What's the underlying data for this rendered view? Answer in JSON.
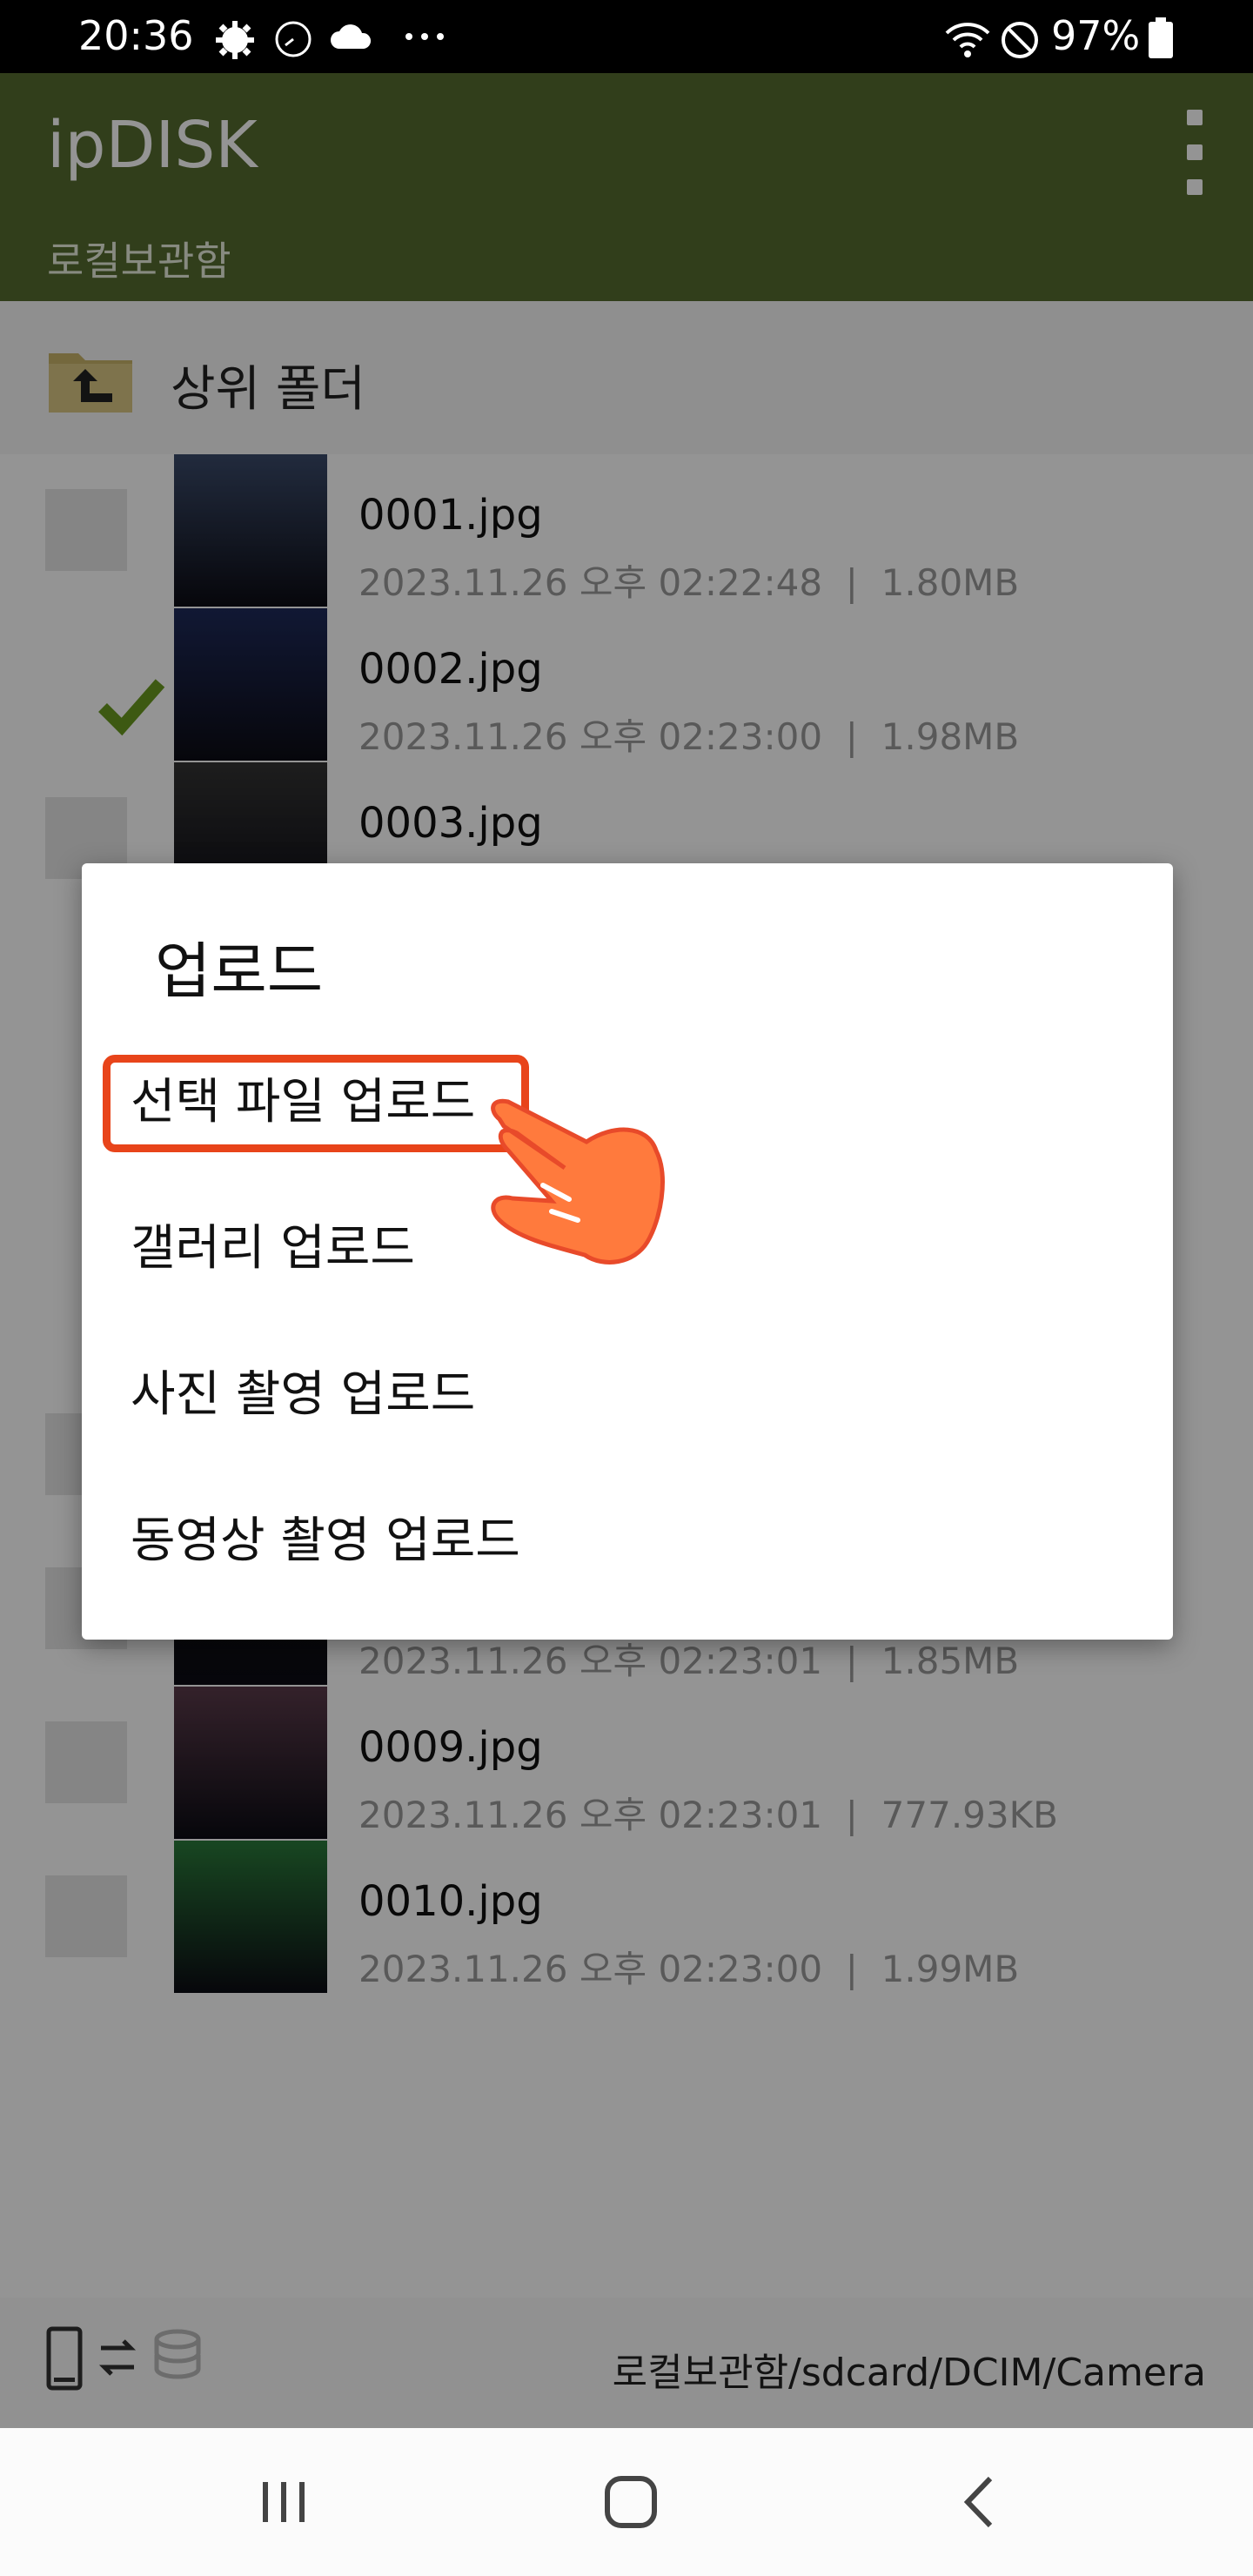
{
  "status_bar": {
    "time": "20:36",
    "battery": "97%"
  },
  "app_bar": {
    "title": "ipDISK",
    "subtitle": "로컬보관함"
  },
  "parent_folder": {
    "label": "상위 폴더"
  },
  "files": [
    {
      "name": "0001.jpg",
      "date": "2023.11.26 오후 02:22:48",
      "size": "1.80MB",
      "checked": false,
      "thumb_color": "#3a4a6a"
    },
    {
      "name": "0002.jpg",
      "date": "2023.11.26 오후 02:23:00",
      "size": "1.98MB",
      "checked": true,
      "thumb_color": "#1e2a5a"
    },
    {
      "name": "0003.jpg",
      "date": "",
      "size": "",
      "checked": false,
      "thumb_color": "#333333"
    },
    {
      "name": "",
      "date": "",
      "size": "",
      "checked": true,
      "thumb_color": "#444444"
    },
    {
      "name": "",
      "date": "",
      "size": "",
      "checked": true,
      "thumb_color": "#555555"
    },
    {
      "name": "",
      "date": "",
      "size": "",
      "checked": true,
      "thumb_color": "#444444"
    },
    {
      "name": "",
      "date": "",
      "size": "",
      "checked": false,
      "thumb_color": "#333333"
    },
    {
      "name": "",
      "date": "2023.11.26 오후 02:23:01",
      "size": "1.85MB",
      "checked": false,
      "thumb_color": "#111111"
    },
    {
      "name": "0009.jpg",
      "date": "2023.11.26 오후 02:23:01",
      "size": "777.93KB",
      "checked": false,
      "thumb_color": "#5a3a4a"
    },
    {
      "name": "0010.jpg",
      "date": "2023.11.26 오후 02:23:00",
      "size": "1.99MB",
      "checked": false,
      "thumb_color": "#2a7a3a"
    }
  ],
  "bottom_bar": {
    "path": "로컬보관함/sdcard/DCIM/Camera"
  },
  "dialog": {
    "title": "업로드",
    "options": [
      {
        "label": "선택 파일 업로드"
      },
      {
        "label": "갤러리 업로드"
      },
      {
        "label": "사진 촬영 업로드"
      },
      {
        "label": "동영상 촬영 업로드"
      }
    ]
  },
  "colors": {
    "app_bar": "#556b2f",
    "check": "#6a9a1f",
    "highlight": "#e8441a",
    "hand": "#ff7a3d"
  }
}
